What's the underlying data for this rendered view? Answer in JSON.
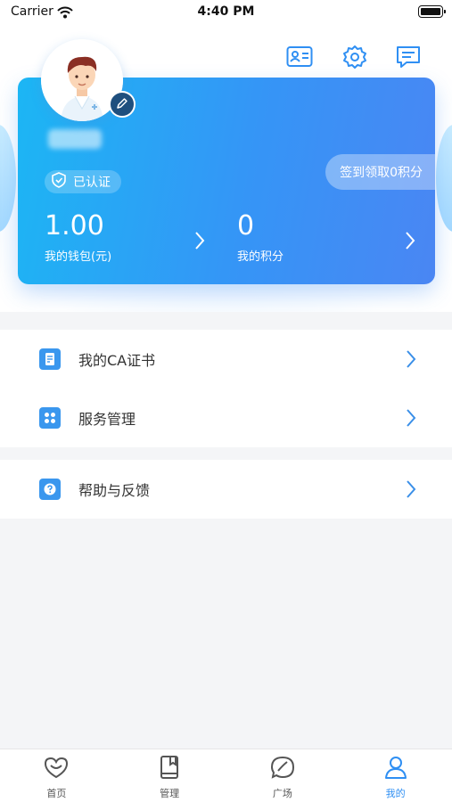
{
  "status_bar": {
    "carrier": "Carrier",
    "time": "4:40 PM"
  },
  "header": {
    "icons": [
      "id-card-icon",
      "gear-icon",
      "message-icon"
    ]
  },
  "profile": {
    "verified_label": "已认证",
    "checkin_label": "签到领取0积分",
    "wallet": {
      "value": "1.00",
      "label": "我的钱包(元)"
    },
    "points": {
      "value": "0",
      "label": "我的积分"
    }
  },
  "menu": {
    "items": [
      {
        "label": "我的CA证书",
        "icon": "certificate-icon"
      },
      {
        "label": "服务管理",
        "icon": "grid-icon"
      },
      {
        "label": "帮助与反馈",
        "icon": "help-icon"
      }
    ]
  },
  "tabbar": {
    "tabs": [
      {
        "label": "首页",
        "icon": "heart-icon"
      },
      {
        "label": "管理",
        "icon": "book-icon"
      },
      {
        "label": "广场",
        "icon": "chat-bubble-icon"
      },
      {
        "label": "我的",
        "icon": "person-icon"
      }
    ],
    "active_index": 3
  },
  "colors": {
    "accent": "#2f8ff3",
    "card_start": "#1cb6f4",
    "card_end": "#4a86f3"
  }
}
